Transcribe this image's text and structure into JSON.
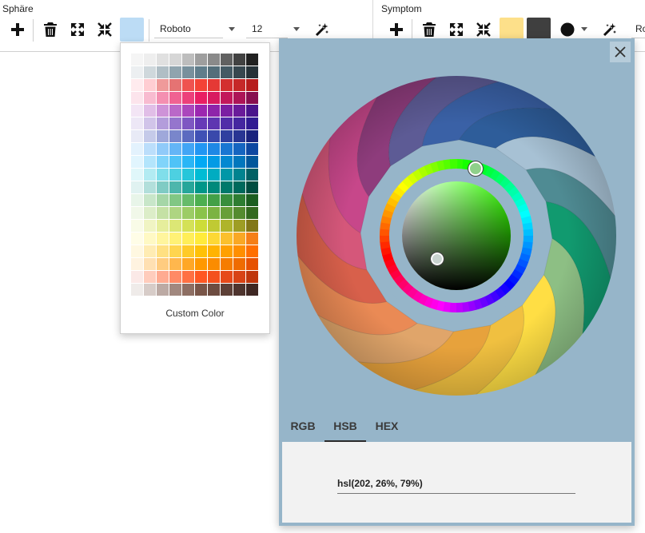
{
  "toolbar": {
    "sphere_group": {
      "label": "Sphäre",
      "fill_color": "#bcdcf5",
      "font": {
        "value": "Roboto"
      },
      "size": {
        "value": "12"
      }
    },
    "symptom_group": {
      "label": "Symptom",
      "fill_color": "#fde08a",
      "stroke_color": "#3f3f3f",
      "font": {
        "value": "Ro"
      }
    }
  },
  "palette": {
    "custom_color_label": "Custom Color",
    "rows": [
      [
        "#f5f5f5",
        "#eeeeee",
        "#e0e0e0",
        "#d6d6d6",
        "#bdbdbd",
        "#9e9e9e",
        "#8a8a8a",
        "#616161",
        "#424242",
        "#212121"
      ],
      [
        "#eceff1",
        "#cfd8dc",
        "#b0bec5",
        "#90a4ae",
        "#78909c",
        "#607d8b",
        "#546e7a",
        "#455a64",
        "#37474f",
        "#263238"
      ],
      [
        "#ffebee",
        "#ffcdd2",
        "#ef9a9a",
        "#e57373",
        "#ef5350",
        "#f44336",
        "#e53935",
        "#d32f2f",
        "#c62828",
        "#b71c1c"
      ],
      [
        "#fce4ec",
        "#f8bbd0",
        "#f48fb1",
        "#f06292",
        "#ec407a",
        "#e91e63",
        "#d81b60",
        "#c2185b",
        "#ad1457",
        "#880e4f"
      ],
      [
        "#f3e5f5",
        "#e1bee7",
        "#ce93d8",
        "#ba68c8",
        "#ab47bc",
        "#9c27b0",
        "#8e24aa",
        "#7b1fa2",
        "#6a1b9a",
        "#4a148c"
      ],
      [
        "#ede7f6",
        "#d1c4e9",
        "#b39ddb",
        "#9575cd",
        "#7e57c2",
        "#673ab7",
        "#5e35b1",
        "#512da8",
        "#4527a0",
        "#311b92"
      ],
      [
        "#e8eaf6",
        "#c5cae9",
        "#9fa8da",
        "#7986cb",
        "#5c6bc0",
        "#3f51b5",
        "#3949ab",
        "#303f9f",
        "#283593",
        "#1a237e"
      ],
      [
        "#e3f2fd",
        "#bbdefb",
        "#90caf9",
        "#64b5f6",
        "#42a5f5",
        "#2196f3",
        "#1e88e5",
        "#1976d2",
        "#1565c0",
        "#0d47a1"
      ],
      [
        "#e1f5fe",
        "#b3e5fc",
        "#81d4fa",
        "#4fc3f7",
        "#29b6f6",
        "#03a9f4",
        "#039be5",
        "#0288d1",
        "#0277bd",
        "#01579b"
      ],
      [
        "#e0f7fa",
        "#b2ebf2",
        "#80deea",
        "#4dd0e1",
        "#26c6da",
        "#00bcd4",
        "#00acc1",
        "#0097a7",
        "#00838f",
        "#006064"
      ],
      [
        "#e0f2f1",
        "#b2dfdb",
        "#80cbc4",
        "#4db6ac",
        "#26a69a",
        "#009688",
        "#00897b",
        "#00796b",
        "#00695c",
        "#004d40"
      ],
      [
        "#e8f5e9",
        "#c8e6c9",
        "#a5d6a7",
        "#81c784",
        "#66bb6a",
        "#4caf50",
        "#43a047",
        "#388e3c",
        "#2e7d32",
        "#1b5e20"
      ],
      [
        "#f1f8e9",
        "#dcedc8",
        "#c5e1a5",
        "#aed581",
        "#9ccc65",
        "#8bc34a",
        "#7cb342",
        "#689f38",
        "#558b2f",
        "#33691e"
      ],
      [
        "#f9fbe7",
        "#f0f4c3",
        "#e6ee9c",
        "#dce775",
        "#d4e157",
        "#cddc39",
        "#c0ca33",
        "#afb42b",
        "#9e9d24",
        "#827717"
      ],
      [
        "#fffde7",
        "#fff9c4",
        "#fff59d",
        "#fff176",
        "#ffee58",
        "#ffeb3b",
        "#fdd835",
        "#fbc02d",
        "#f9a825",
        "#f57f17"
      ],
      [
        "#fff8e1",
        "#ffecb3",
        "#ffe082",
        "#ffd54f",
        "#ffca28",
        "#ffc107",
        "#ffb300",
        "#ffa000",
        "#ff8f00",
        "#ff6f00"
      ],
      [
        "#fff3e0",
        "#ffe0b2",
        "#ffcc80",
        "#ffb74d",
        "#ffa726",
        "#ff9800",
        "#fb8c00",
        "#f57c00",
        "#ef6c00",
        "#e65100"
      ],
      [
        "#fbe9e7",
        "#ffccbc",
        "#ffab91",
        "#ff8a65",
        "#ff7043",
        "#ff5722",
        "#f4511e",
        "#e64a19",
        "#d84315",
        "#bf360c"
      ],
      [
        "#efebe9",
        "#d7ccc8",
        "#bcaaa4",
        "#a1887f",
        "#8d6e63",
        "#795548",
        "#6d4c41",
        "#5d4037",
        "#4e342e",
        "#3e2723"
      ]
    ]
  },
  "picker": {
    "background": "#96b5c9",
    "tabs": [
      {
        "label": "RGB"
      },
      {
        "label": "HSB",
        "active": true
      },
      {
        "label": "HEX"
      }
    ],
    "value": "hsl(202, 26%, 79%)",
    "petals": [
      "#e0a56a",
      "#ea8a55",
      "#d8604b",
      "#d5577a",
      "#c7478a",
      "#8e3c7c",
      "#5d5b95",
      "#3a61a6",
      "#2e5d9a",
      "#a7c1d4",
      "#4f8b93",
      "#119a6f",
      "#8dbf84",
      "#ffde44",
      "#f0c040",
      "#e7a23c"
    ]
  }
}
